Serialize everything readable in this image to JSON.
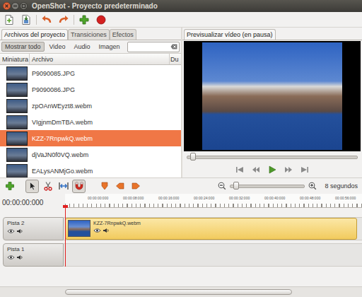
{
  "window": {
    "title": "OpenShot - Proyecto predeterminado"
  },
  "toolbar": [
    {
      "kind": "new"
    },
    {
      "kind": "save"
    },
    {
      "kind": "undo"
    },
    {
      "kind": "redo"
    },
    {
      "kind": "import"
    },
    {
      "kind": "export"
    }
  ],
  "panel_tabs": [
    {
      "label": "Archivos del proyecto",
      "selected": true
    },
    {
      "label": "Transiciones",
      "selected": false
    },
    {
      "label": "Efectos",
      "selected": false
    }
  ],
  "filters": [
    {
      "label": "Mostrar todo",
      "selected": true
    },
    {
      "label": "Video",
      "selected": false
    },
    {
      "label": "Audio",
      "selected": false
    },
    {
      "label": "Imagen",
      "selected": false
    }
  ],
  "search": {
    "value": ""
  },
  "table": {
    "columns": [
      "Miniatura",
      "Archivo",
      "Du"
    ],
    "rows": [
      {
        "file": "P9090085.JPG",
        "selected": false
      },
      {
        "file": "P9090086.JPG",
        "selected": false
      },
      {
        "file": "zpOAnWEyzt8.webm",
        "selected": false
      },
      {
        "file": "VIgjnmDmTBA.webm",
        "selected": false
      },
      {
        "file": "KZZ-7RnpwkQ.webm",
        "selected": true
      },
      {
        "file": "djVaJN0f0VQ.webm",
        "selected": false
      },
      {
        "file": "EALysANMjGo.webm",
        "selected": false
      }
    ]
  },
  "preview": {
    "tab": {
      "label": "Previsualizar vídeo (en pausa)",
      "selected": true
    },
    "seek": {
      "level": 0.02
    },
    "controls": [
      {
        "kind": "first"
      },
      {
        "kind": "rewind"
      },
      {
        "kind": "play"
      },
      {
        "kind": "forward"
      },
      {
        "kind": "last"
      }
    ]
  },
  "timeline": {
    "tools": [
      {
        "kind": "add",
        "selected": false
      },
      {
        "kind": "pointer",
        "selected": true
      },
      {
        "kind": "razor",
        "selected": false
      },
      {
        "kind": "resize",
        "selected": false
      },
      {
        "kind": "snap",
        "selected": true
      },
      {
        "kind": "marker",
        "selected": false
      },
      {
        "kind": "previous-marker",
        "selected": false
      },
      {
        "kind": "next-marker",
        "selected": false
      }
    ],
    "zoom": {
      "level": 0.05,
      "label": "8 segundos"
    },
    "time": "00:00:00:000",
    "ruler": [
      "00:00:00:000",
      "00:00:08:000",
      "00:00:16:000",
      "00:00:24:000",
      "00:00:32:000",
      "00:00:40:000",
      "00:00:48:000",
      "00:00:56:000"
    ],
    "playhead": {
      "level": 0
    },
    "tracks": [
      {
        "name": "Pista 2",
        "clips": [
          {
            "label": "KZZ-7RnpwkQ.webm"
          }
        ]
      },
      {
        "name": "Pista 1",
        "clips": []
      }
    ],
    "scroll": {
      "level": 0.78
    }
  }
}
